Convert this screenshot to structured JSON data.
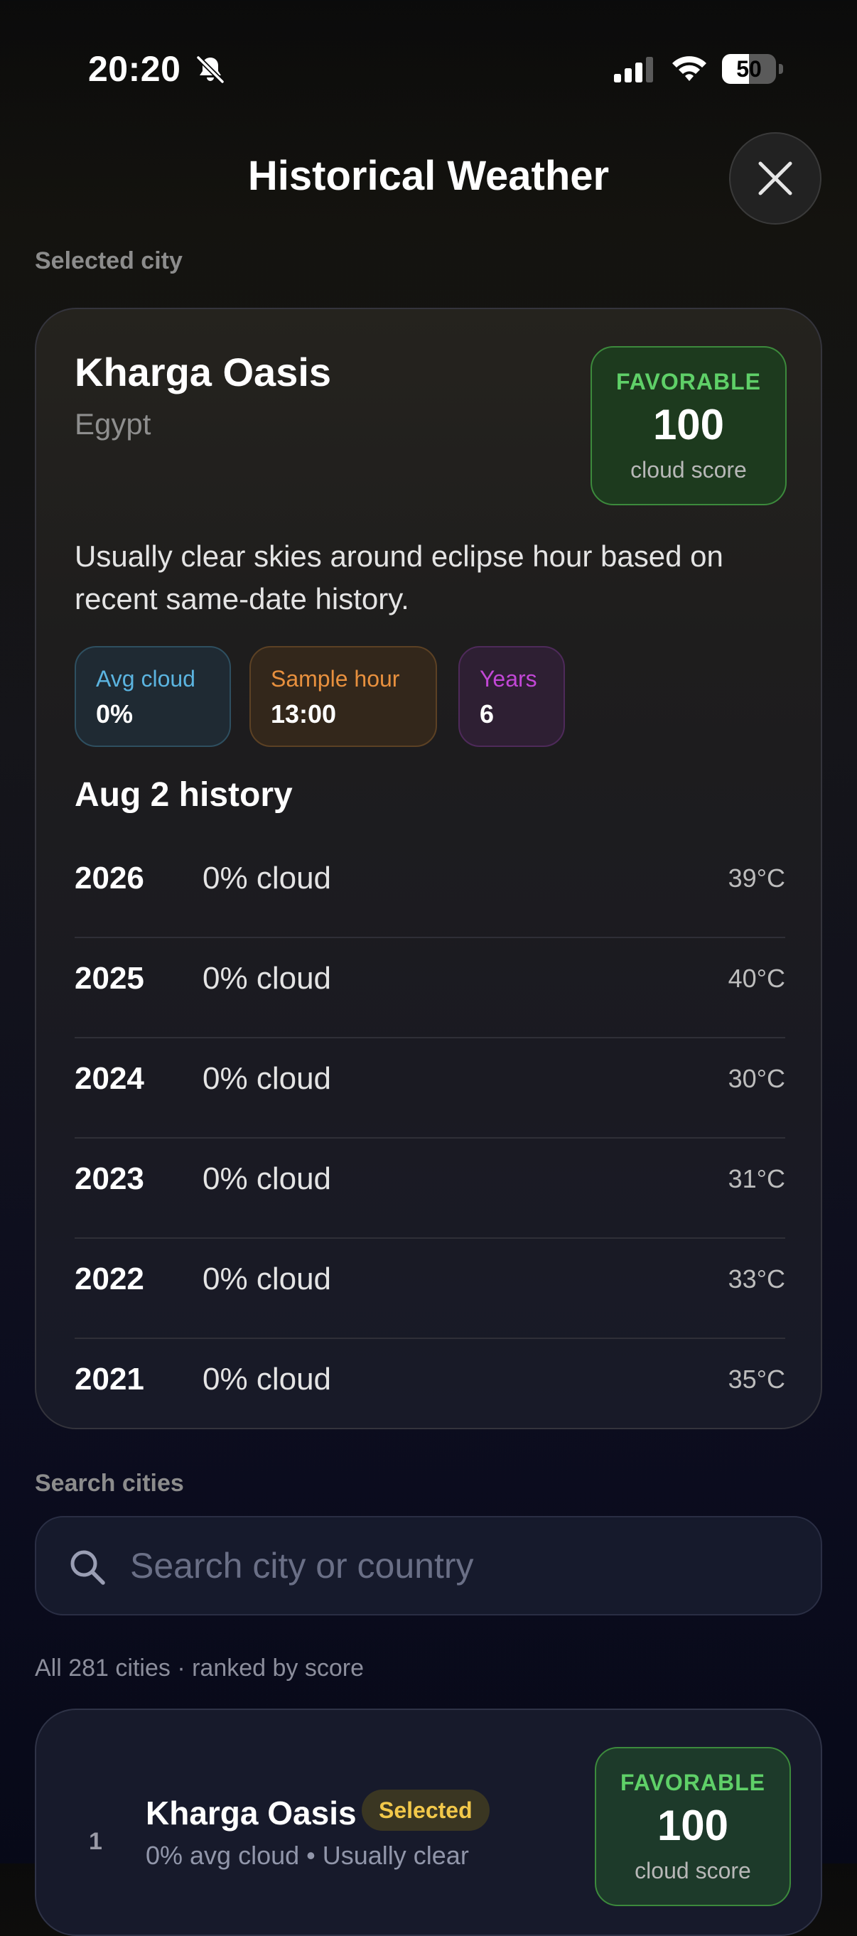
{
  "status_bar": {
    "time": "20:20",
    "battery_level": "50",
    "icons": [
      "bell-slash-icon",
      "cellular-signal-icon",
      "wifi-icon",
      "battery-icon"
    ]
  },
  "header": {
    "title": "Historical Weather",
    "close_icon": "x-mark-icon"
  },
  "selected_section": {
    "label": "Selected city"
  },
  "selected_city": {
    "name": "Kharga Oasis",
    "country": "Egypt",
    "score": {
      "status": "FAVORABLE",
      "value": "100",
      "label": "cloud score",
      "color": "#5fd068"
    },
    "description": "Usually clear skies around eclipse hour based on recent same-date history.",
    "stats": {
      "avg_cloud": {
        "label": "Avg cloud",
        "value": "0%",
        "color": "#5bb4e0"
      },
      "sample_hour": {
        "label": "Sample hour",
        "value": "13:00",
        "color": "#e8903e"
      },
      "years": {
        "label": "Years",
        "value": "6",
        "color": "#c247d6"
      }
    },
    "history": {
      "title": "Aug 2 history",
      "rows": [
        {
          "year": "2026",
          "cloud": "0% cloud",
          "temp": "39°C"
        },
        {
          "year": "2025",
          "cloud": "0% cloud",
          "temp": "40°C"
        },
        {
          "year": "2024",
          "cloud": "0% cloud",
          "temp": "30°C"
        },
        {
          "year": "2023",
          "cloud": "0% cloud",
          "temp": "31°C"
        },
        {
          "year": "2022",
          "cloud": "0% cloud",
          "temp": "33°C"
        },
        {
          "year": "2021",
          "cloud": "0% cloud",
          "temp": "35°C"
        }
      ]
    }
  },
  "search": {
    "label": "Search cities",
    "placeholder": "Search city or country",
    "value": "",
    "icon": "magnifying-glass-icon"
  },
  "list": {
    "summary": "All 281 cities · ranked by score",
    "items": [
      {
        "rank": "1",
        "name": "Kharga Oasis",
        "badge": "Selected",
        "meta": "0% avg cloud • Usually clear",
        "score_status": "FAVORABLE",
        "score_value": "100",
        "score_label": "cloud score"
      }
    ]
  }
}
